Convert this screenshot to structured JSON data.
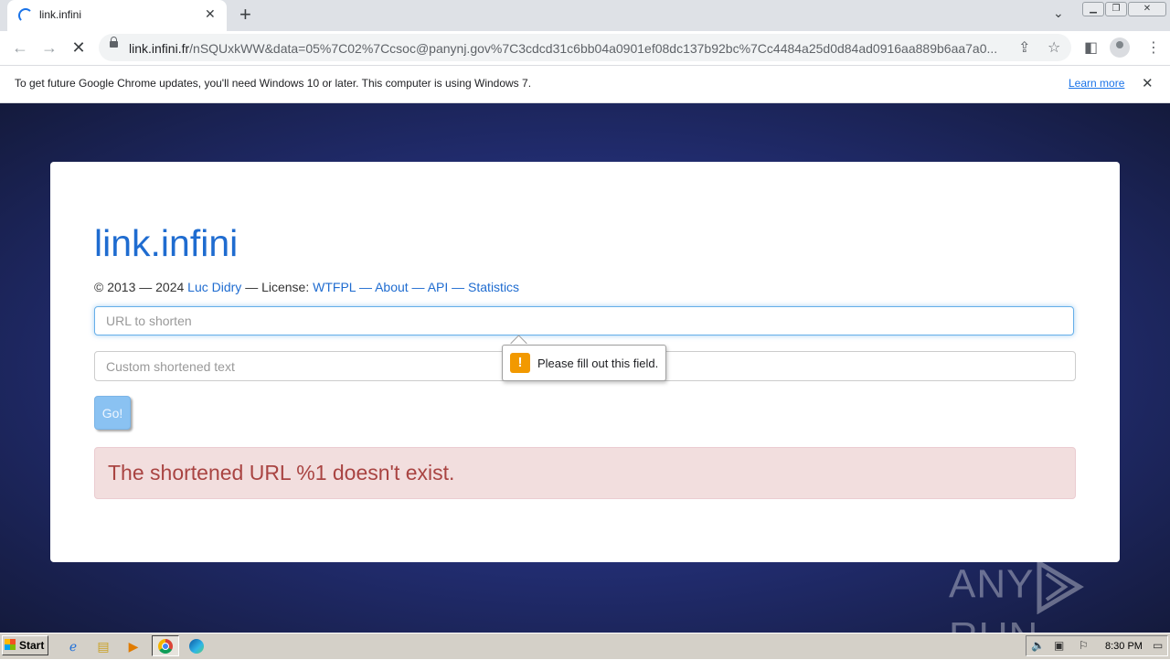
{
  "browser": {
    "tab_title": "link.infini",
    "url_host": "link.infini.fr",
    "url_path": "/nSQUxkWW&data=05%7C02%7Ccsoc@panynj.gov%7C3cdcd31c6bb04a0901ef08dc137b92bc%7Cc4484a25d0d84ad0916aa889b6aa7a0..."
  },
  "infobar": {
    "text": "To get future Google Chrome updates, you'll need Windows 10 or later. This computer is using Windows 7.",
    "learn_more": "Learn more"
  },
  "page": {
    "site_title": "link.infini",
    "footer": {
      "copyright": "© 2013 — 2024 ",
      "author": "Luc Didry",
      "license_prefix": " — License: ",
      "license": "WTFPL",
      "sep1": " — ",
      "about": "About",
      "sep2": " — ",
      "api": "API",
      "sep3": " — ",
      "statistics": "Statistics"
    },
    "url_input_placeholder": "URL to shorten",
    "url_input_value": "",
    "custom_input_placeholder": "Custom shortened text",
    "custom_input_value": "",
    "go_label": "Go!",
    "error_message": "The shortened URL %1 doesn't exist.",
    "validation_message": "Please fill out this field."
  },
  "watermark": {
    "left": "ANY",
    "right": "RUN"
  },
  "taskbar": {
    "start_label": "Start",
    "clock": "8:30 PM"
  }
}
